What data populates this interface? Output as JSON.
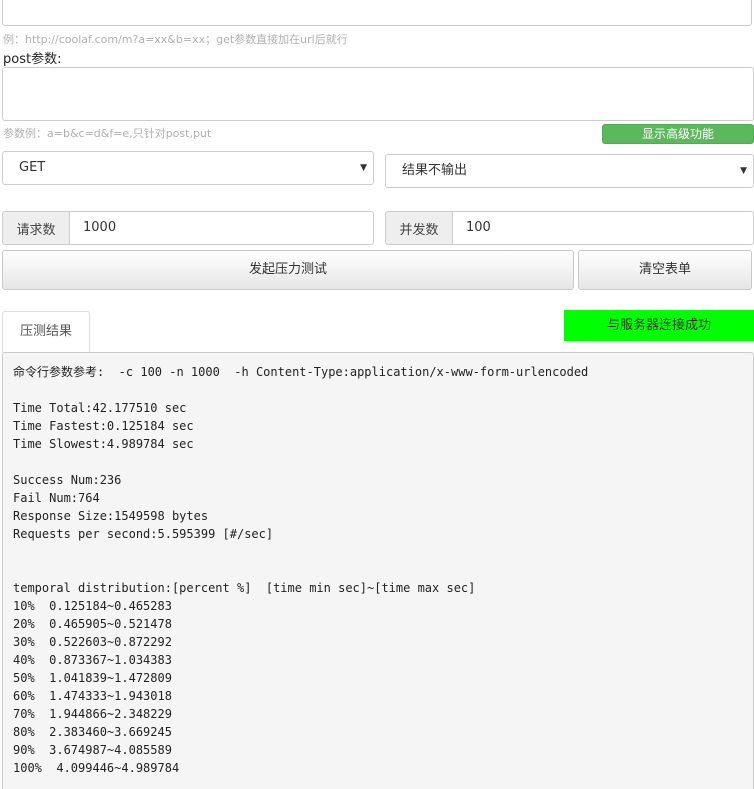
{
  "form": {
    "url_hint": "例：http://coolaf.com/m?a=xx&b=xx；get参数直接加在url后就行",
    "post_label": "post参数:",
    "post_hint": "参数例：a=b&c=d&f=e,只针对post,put",
    "advanced_button": "显示高级功能",
    "method_select": "GET",
    "output_select": "结果不输出",
    "requests_label": "请求数",
    "requests_value": "1000",
    "concurrency_label": "并发数",
    "concurrency_value": "100",
    "start_button": "发起压力测试",
    "clear_button": "清空表单"
  },
  "results": {
    "tab_label": "压测结果",
    "status": "与服务器连接成功",
    "status_color": "#00ff00",
    "lines": [
      "命令行参数参考:  -c 100 -n 1000  -h Content-Type:application/x-www-form-urlencoded",
      "",
      "Time Total:42.177510 sec",
      "Time Fastest:0.125184 sec",
      "Time Slowest:4.989784 sec",
      "",
      "Success Num:236",
      "Fail Num:764",
      "Response Size:1549598 bytes",
      "Requests per second:5.595399 [#/sec]",
      "",
      "",
      "temporal distribution:[percent %]  [time min sec]~[time max sec]",
      "10%  0.125184~0.465283",
      "20%  0.465905~0.521478",
      "30%  0.522603~0.872292",
      "40%  0.873367~1.034383",
      "50%  1.041839~1.472809",
      "60%  1.474333~1.943018",
      "70%  1.944866~2.348229",
      "80%  2.383460~3.669245",
      "90%  3.674987~4.085589",
      "100%  4.099446~4.989784"
    ]
  }
}
